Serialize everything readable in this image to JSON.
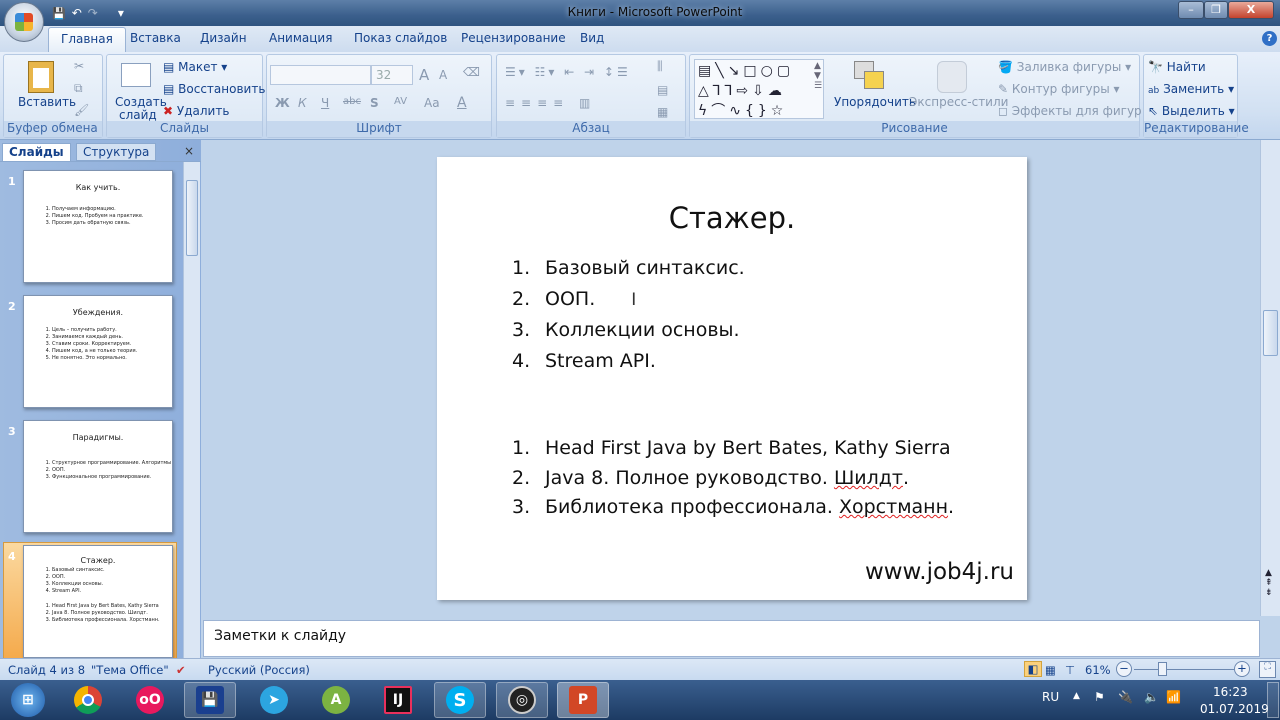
{
  "window": {
    "title": "Книги - Microsoft PowerPoint",
    "minimize": "–",
    "restore": "❐",
    "close": "X",
    "help": "?"
  },
  "quick_access": {
    "save": "💾",
    "undo": "↶",
    "redo": "↷",
    "more": "▾"
  },
  "tabs": [
    "Главная",
    "Вставка",
    "Дизайн",
    "Анимация",
    "Показ слайдов",
    "Рецензирование",
    "Вид"
  ],
  "ribbon": {
    "clipboard": {
      "label": "Буфер обмена",
      "paste": "Вставить"
    },
    "slides": {
      "label": "Слайды",
      "new_slide_1": "Создать",
      "new_slide_2": "слайд",
      "layout": "Макет",
      "reset": "Восстановить",
      "delete": "Удалить"
    },
    "font": {
      "label": "Шрифт",
      "font_name": "",
      "font_size": "32",
      "bold": "Ж",
      "italic": "К",
      "underline": "Ч",
      "strike": "abc",
      "shadow": "S",
      "spacing": "AV",
      "case": "Aa",
      "color": "A",
      "grow": "A",
      "shrink": "A"
    },
    "paragraph": {
      "label": "Абзац"
    },
    "drawing": {
      "label": "Рисование",
      "arrange": "Упорядочить",
      "quick_styles": "Экспресс-стили",
      "fill": "Заливка фигуры",
      "outline": "Контур фигуры",
      "effects": "Эффекты для фигур"
    },
    "editing": {
      "label": "Редактирование",
      "find": "Найти",
      "replace": "Заменить",
      "select": "Выделить"
    }
  },
  "left_pane": {
    "tab_slides": "Слайды",
    "tab_outline": "Структура",
    "close": "×"
  },
  "thumbnails": [
    {
      "num": "1",
      "title": "Как учить.",
      "items": [
        "Получаем информацию.",
        "Пишем код. Пробуем на практике.",
        "Просим дать обратную связь."
      ]
    },
    {
      "num": "2",
      "title": "Убеждения.",
      "items": [
        "Цель – получить работу.",
        "Занимаемся каждый день.",
        "Ставим сроки. Корректируем.",
        "Пишем код, а не только теория.",
        "Не понятно. Это нормально."
      ]
    },
    {
      "num": "3",
      "title": "Парадигмы.",
      "items": [
        "Структурное программирование. Алгоритмы",
        "ООП.",
        "Функциональное программирование."
      ]
    },
    {
      "num": "4",
      "title": "Стажер.",
      "items": [
        "Базовый синтаксис.",
        "ООП.",
        "Коллекции основы.",
        "Stream API."
      ],
      "items2": [
        "Head First Java by Bert Bates, Kathy Sierra",
        "Java 8. Полное руководство. Шилдт.",
        "Библиотека профессионала. Хорстманн."
      ]
    }
  ],
  "slide": {
    "title": "Стажер.",
    "list1": [
      {
        "n": "1.",
        "t": "Базовый синтаксис."
      },
      {
        "n": "2.",
        "t": "ООП."
      },
      {
        "n": "3.",
        "t": "Коллекции основы."
      },
      {
        "n": "4.",
        "t": "Stream API."
      }
    ],
    "list2": [
      {
        "n": "1.",
        "t": "Head First Java by Bert Bates, Kathy Sierra"
      },
      {
        "n": "2.",
        "t": "Java 8. Полное руководство. ",
        "sq": "Шилдт",
        "end": "."
      },
      {
        "n": "3.",
        "t": "Библиотека профессионала. ",
        "sq": "Хорстманн",
        "end": "."
      }
    ],
    "footer": "www.job4j.ru"
  },
  "notes": {
    "placeholder": "Заметки к слайду"
  },
  "status": {
    "slide": "Слайд 4 из 8",
    "theme": "\"Тема Office\"",
    "language": "Русский (Россия)",
    "zoom": "61%",
    "zoom_percent": 61
  },
  "taskbar": {
    "apps": [
      "start",
      "chrome",
      "flickr",
      "floppy",
      "telegram",
      "android-studio",
      "intellij",
      "skype",
      "obs",
      "powerpoint"
    ],
    "lang": "RU",
    "time": "16:23",
    "date": "01.07.2019"
  }
}
